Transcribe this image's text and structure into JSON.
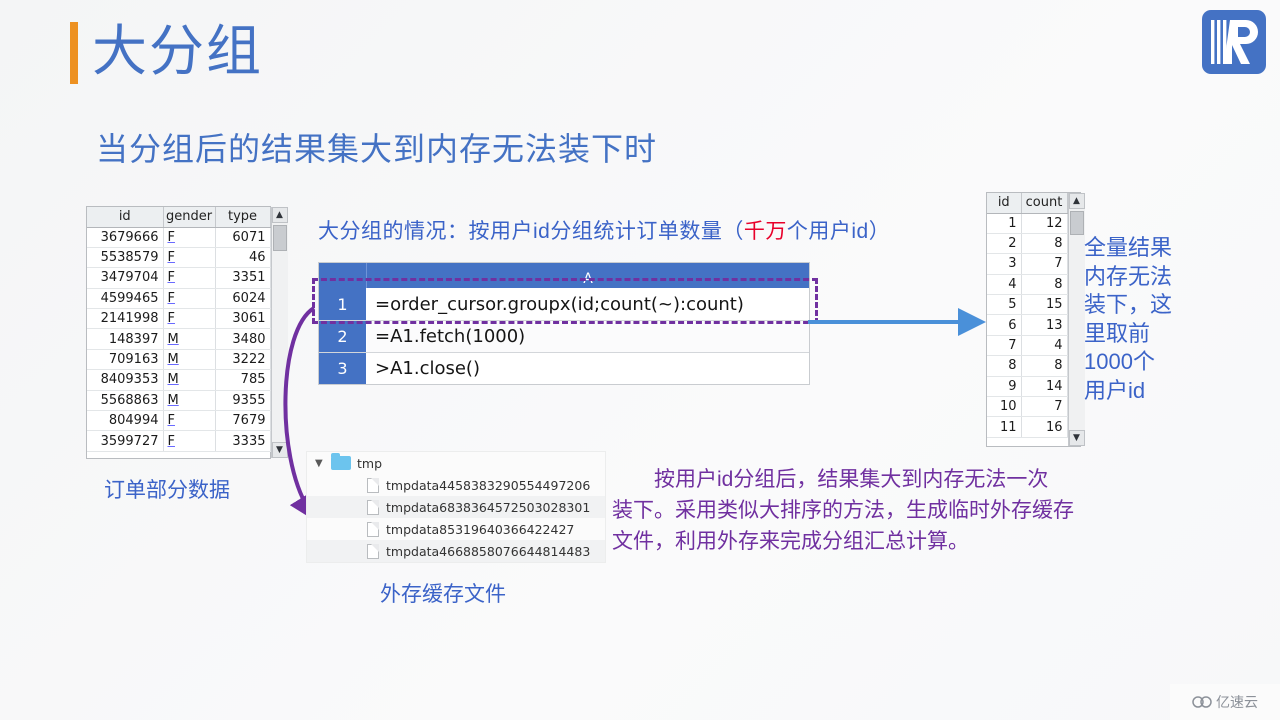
{
  "slide": {
    "title": "大分组",
    "subtitle": "当分组后的结果集大到内存无法装下时",
    "accent_bar_color": "#ed9121",
    "title_color": "#4472c4"
  },
  "logo": {
    "name": "raqsoft-logo",
    "letter": "R",
    "color": "#4472c4"
  },
  "orders_table": {
    "label": "订单部分数据",
    "headers": [
      "id",
      "gender",
      "type"
    ],
    "rows": [
      [
        "3679666",
        "F",
        "6071"
      ],
      [
        "5538579",
        "F",
        "46"
      ],
      [
        "3479704",
        "F",
        "3351"
      ],
      [
        "4599465",
        "F",
        "6024"
      ],
      [
        "2141998",
        "F",
        "3061"
      ],
      [
        "148397",
        "M",
        "3480"
      ],
      [
        "709163",
        "M",
        "3222"
      ],
      [
        "8409353",
        "M",
        "785"
      ],
      [
        "5568863",
        "M",
        "9355"
      ],
      [
        "804994",
        "F",
        "7679"
      ],
      [
        "3599727",
        "F",
        "3335"
      ]
    ]
  },
  "result_table": {
    "headers": [
      "id",
      "count"
    ],
    "rows": [
      [
        "1",
        "12"
      ],
      [
        "2",
        "8"
      ],
      [
        "3",
        "7"
      ],
      [
        "4",
        "8"
      ],
      [
        "5",
        "15"
      ],
      [
        "6",
        "13"
      ],
      [
        "7",
        "4"
      ],
      [
        "8",
        "8"
      ],
      [
        "9",
        "14"
      ],
      [
        "10",
        "7"
      ],
      [
        "11",
        "16"
      ]
    ]
  },
  "code_editor": {
    "column_header": "A",
    "rows": [
      {
        "number": "1",
        "code": "=order_cursor.groupx(id;count(~):count)"
      },
      {
        "number": "2",
        "code": "=A1.fetch(1000)"
      },
      {
        "number": "3",
        "code": ">A1.close()"
      }
    ]
  },
  "file_tree": {
    "label": "外存缓存文件",
    "root": "tmp",
    "files": [
      "tmpdata4458383290554497206",
      "tmpdata6838364572503028301",
      "tmpdata85319640366422427",
      "tmpdata4668858076644814483"
    ]
  },
  "annotations": {
    "top_prefix": "大分组的情况：按用户id分组统计订单数量（",
    "top_highlight": "千万",
    "top_suffix": "个用户id）",
    "right_lines": [
      "全量结果",
      "内存无法",
      "装下，这",
      "里取前",
      "1000个",
      "用户id"
    ],
    "bottom_lines": [
      "　　按用户id分组后，结果集大到内存无法一次",
      "装下。采用类似大排序的方法，生成临时外存缓存",
      "文件，利用外存来完成分组汇总计算。"
    ]
  },
  "watermark": {
    "text": "亿速云",
    "icon": "cloud-icon"
  }
}
